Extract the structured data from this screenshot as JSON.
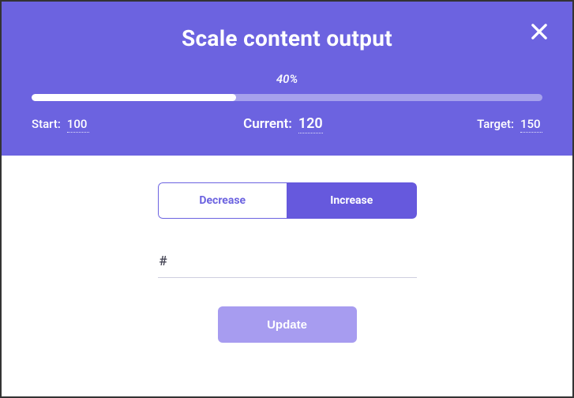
{
  "colors": {
    "primary": "#6c63e0",
    "primaryDark": "#6659dd",
    "updateBtn": "#a79cf0"
  },
  "dialog": {
    "title": "Scale content output",
    "progress": {
      "percent_label": "40%",
      "percent_value": 40
    },
    "stats": {
      "start": {
        "label": "Start:",
        "value": "100"
      },
      "current": {
        "label": "Current:",
        "value": "120"
      },
      "target": {
        "label": "Target:",
        "value": "150"
      }
    },
    "segments": {
      "decrease": "Decrease",
      "increase": "Increase",
      "active": "increase"
    },
    "input": {
      "prefix": "#",
      "value": ""
    },
    "actions": {
      "update": "Update"
    }
  }
}
